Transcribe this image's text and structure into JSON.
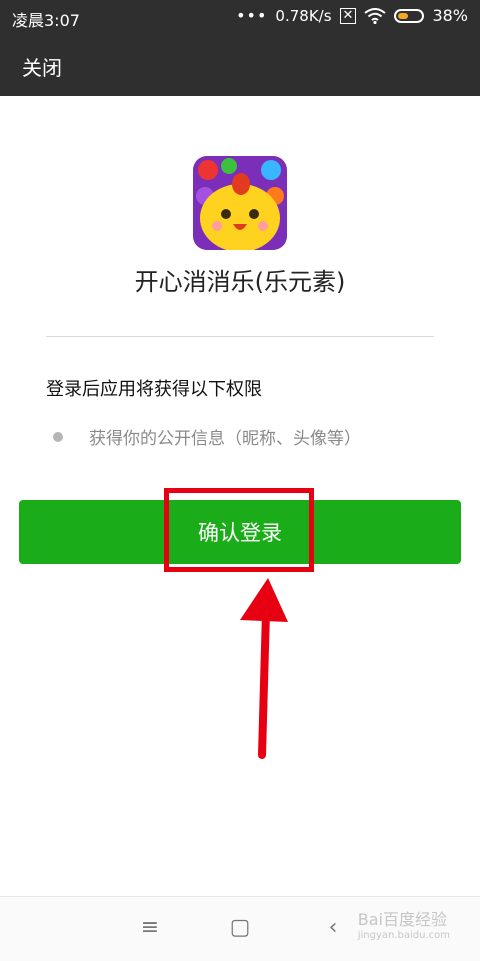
{
  "status_bar": {
    "time": "凌晨3:07",
    "dots": "•••",
    "network_speed": "0.78K/s",
    "battery": "38%",
    "battery_level_percent": 38
  },
  "title_bar": {
    "close": "关闭"
  },
  "app": {
    "name": "开心消消乐(乐元素)"
  },
  "permissions": {
    "title": "登录后应用将获得以下权限",
    "items": [
      {
        "label": "获得你的公开信息（昵称、头像等）"
      }
    ]
  },
  "confirm_button": {
    "label": "确认登录",
    "color": "#1aad19"
  },
  "annotation": {
    "highlight_color": "#e60012"
  },
  "nav": {
    "menu": "≡",
    "home": "▢",
    "back": "‹"
  },
  "watermark": {
    "brand": "Bai百度经验",
    "url": "jingyan.baidu.com"
  }
}
